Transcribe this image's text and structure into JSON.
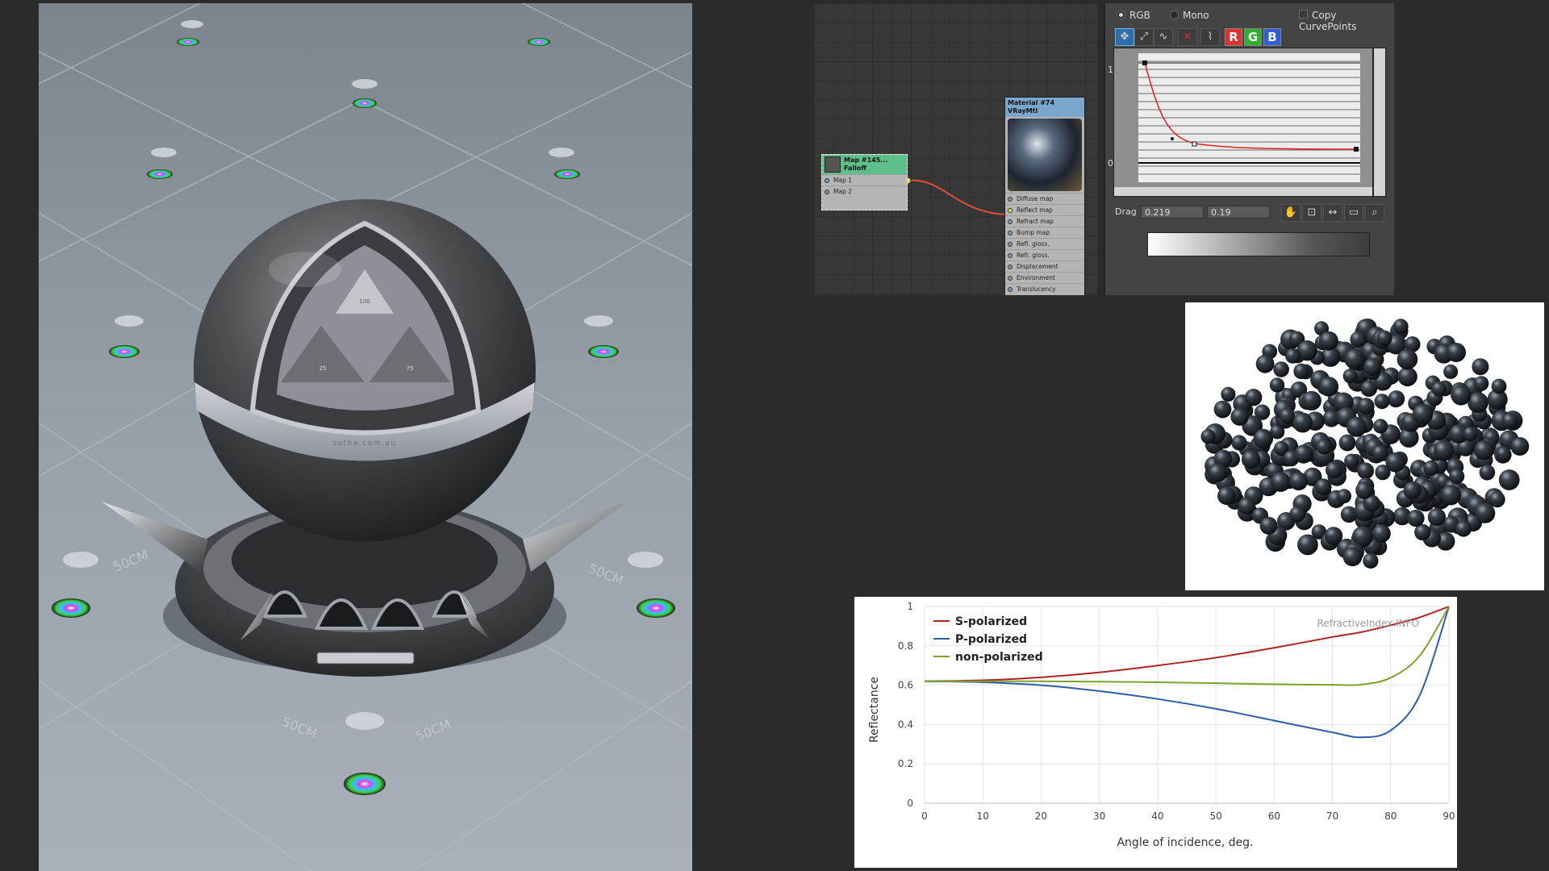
{
  "render": {
    "floor_label": "50CM",
    "band_text": "sathe.com.au",
    "triangle_numbers": [
      "100",
      "25",
      "75"
    ]
  },
  "node_editor": {
    "map_node": {
      "title_1": "Map #145...",
      "title_2": "Falloff",
      "slots": [
        "Map 1",
        "Map 2"
      ]
    },
    "material_node": {
      "title_1": "Material #74",
      "title_2": "VRayMtl",
      "slots": [
        "Diffuse map",
        "Reflect map",
        "Refract map",
        "Bump map",
        "Refl. gloss.",
        "Refr. gloss.",
        "Displacement",
        "Environment",
        "Translucency"
      ]
    }
  },
  "curve_editor": {
    "rgb_label": "RGB",
    "mono_label": "Mono",
    "copy_label": "Copy CurvePoints",
    "r_label": "R",
    "g_label": "G",
    "b_label": "B",
    "y_top": "1",
    "y_bottom": "0",
    "drag_label": "Drag",
    "field1": "0.219",
    "field2": "0.19",
    "colors": {
      "curve": "#e02020",
      "r": "#e03030",
      "g": "#30b030",
      "b": "#2f5fd8"
    }
  },
  "chart_data": {
    "type": "line",
    "xlabel": "Angle of incidence, deg.",
    "ylabel": "Reflectance",
    "xlim": [
      0,
      90
    ],
    "ylim": [
      0,
      1
    ],
    "x_ticks": [
      "0",
      "10",
      "20",
      "30",
      "40",
      "50",
      "60",
      "70",
      "80",
      "90"
    ],
    "y_ticks": [
      "0",
      "0.2",
      "0.4",
      "0.6",
      "0.8",
      "1"
    ],
    "watermark": "RefractiveIndex.INFO",
    "legend_position": "top-left",
    "grid": true,
    "x": [
      0,
      10,
      20,
      30,
      40,
      50,
      60,
      70,
      75,
      80,
      85,
      90
    ],
    "series": [
      {
        "name": "S-polarized",
        "color": "#b22222",
        "values": [
          0.62,
          0.625,
          0.64,
          0.665,
          0.7,
          0.74,
          0.79,
          0.845,
          0.87,
          0.905,
          0.945,
          1.0
        ]
      },
      {
        "name": "P-polarized",
        "color": "#2b5fa8",
        "values": [
          0.62,
          0.615,
          0.6,
          0.57,
          0.53,
          0.48,
          0.42,
          0.36,
          0.335,
          0.37,
          0.55,
          1.0
        ]
      },
      {
        "name": "non-polarized",
        "color": "#7ca32b",
        "values": [
          0.62,
          0.62,
          0.62,
          0.618,
          0.615,
          0.61,
          0.605,
          0.602,
          0.603,
          0.638,
          0.75,
          1.0
        ]
      }
    ]
  }
}
